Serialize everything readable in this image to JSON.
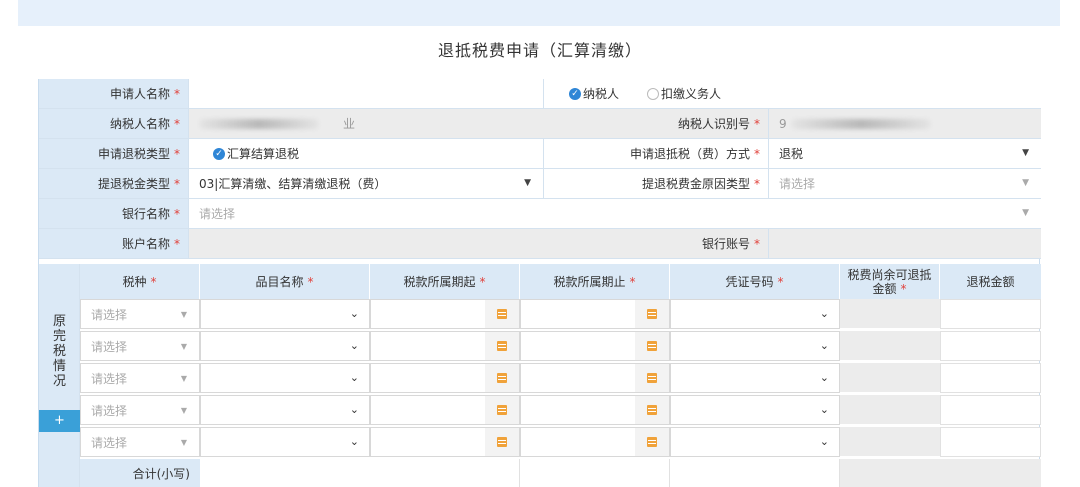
{
  "title": "退抵税费申请（汇算清缴）",
  "required_mark": "*",
  "form": {
    "applicant_name_label": "申请人名称",
    "taxpayer_option": "纳税人",
    "withholding_option": "扣缴义务人",
    "taxpayer_name_label": "纳税人名称",
    "taxpayer_name_tail": "业",
    "taxpayer_id_label": "纳税人识别号",
    "taxpayer_id_prefix": "9",
    "refund_type_label": "申请退税类型",
    "refund_type_value": "汇算结算退税",
    "refund_method_label": "申请退抵税（费）方式",
    "refund_method_value": "退税",
    "refund_amount_type_label": "提退税金类型",
    "refund_amount_type_value": "03|汇算清缴、结算清缴退税（费）",
    "refund_reason_type_label": "提退税费金原因类型",
    "refund_reason_type_placeholder": "请选择",
    "bank_name_label": "银行名称",
    "bank_name_placeholder": "请选择",
    "account_name_label": "账户名称",
    "bank_account_label": "银行账号"
  },
  "grid": {
    "side_label": "原完税情况",
    "add_button": "+",
    "headers": {
      "tax_type": "税种",
      "item_name": "品目名称",
      "period_start": "税款所属期起",
      "period_end": "税款所属期止",
      "voucher_no": "凭证号码",
      "remaining": "税费尚余可退抵金额",
      "refund_amount": "退税金额"
    },
    "rows": [
      {
        "tax_type": "请选择"
      },
      {
        "tax_type": "请选择"
      },
      {
        "tax_type": "请选择"
      },
      {
        "tax_type": "请选择"
      },
      {
        "tax_type": "请选择"
      }
    ],
    "total_label": "合计(小写)"
  },
  "colors": {
    "label_bg": "#dbe9f6",
    "readonly_bg": "#ececec",
    "accent": "#2f86d6",
    "required": "#e0403a",
    "calendar": "#f0a23a"
  }
}
